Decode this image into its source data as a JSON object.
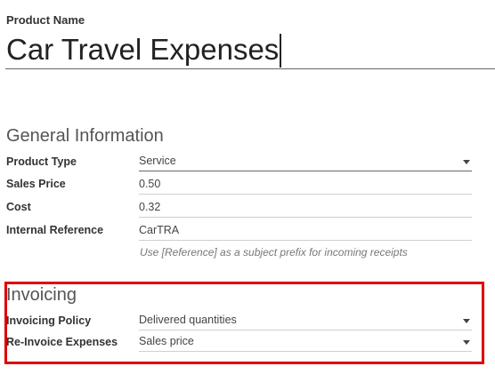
{
  "product": {
    "name_label": "Product Name",
    "name_value": "Car Travel Expenses"
  },
  "general": {
    "title": "General Information",
    "product_type_label": "Product Type",
    "product_type_value": "Service",
    "sales_price_label": "Sales Price",
    "sales_price_value": "0.50",
    "cost_label": "Cost",
    "cost_value": "0.32",
    "internal_ref_label": "Internal Reference",
    "internal_ref_value": "CarTRA",
    "internal_ref_hint": "Use [Reference] as a subject prefix for incoming receipts"
  },
  "invoicing": {
    "title": "Invoicing",
    "policy_label": "Invoicing Policy",
    "policy_value": "Delivered quantities",
    "reinvoice_label": "Re-Invoice Expenses",
    "reinvoice_value": "Sales price"
  },
  "colors": {
    "highlight": "#e00000",
    "text": "#4c4c4c"
  }
}
